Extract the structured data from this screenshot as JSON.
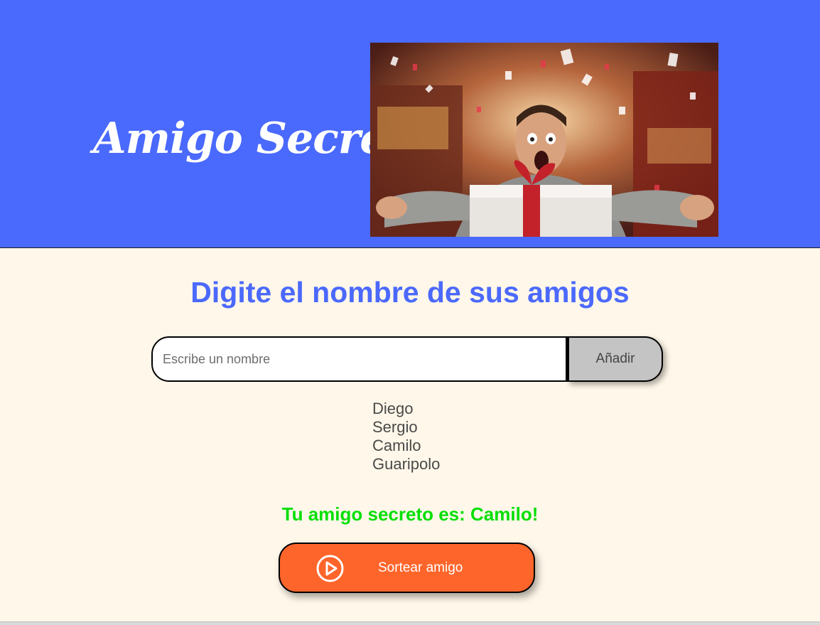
{
  "header": {
    "title": "Amigo Secreto",
    "background_color": "#4a69fd",
    "image": "celebrating man holding a gift box with confetti"
  },
  "main": {
    "heading": "Digite el nombre de sus amigos",
    "input": {
      "placeholder": "Escribe un nombre",
      "value": ""
    },
    "add_button_label": "Añadir",
    "friends": [
      "Diego",
      "Sergio",
      "Camilo",
      "Guaripolo"
    ],
    "result_text": "Tu amigo secreto es: Camilo!",
    "draw_button": {
      "label": "Sortear amigo",
      "icon": "play-circle-icon"
    },
    "colors": {
      "background": "#fff7e9",
      "heading": "#4b69fd",
      "result": "#05df05",
      "draw_button": "#fe652b",
      "add_button": "#c4c4c4"
    }
  }
}
